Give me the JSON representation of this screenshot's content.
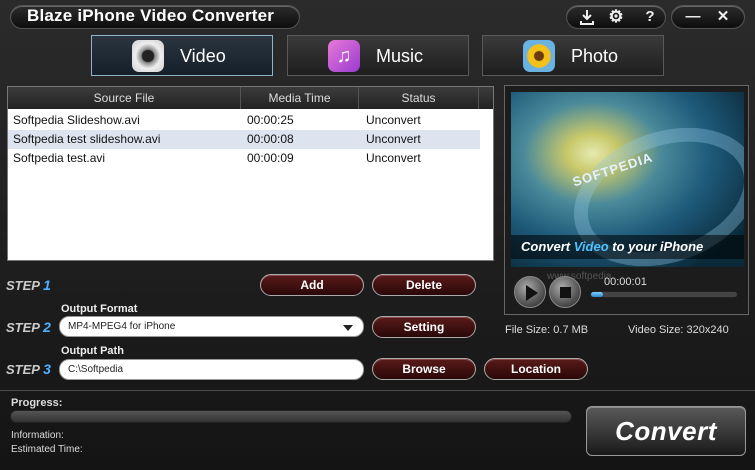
{
  "window": {
    "title": "Blaze iPhone Video Converter",
    "controls": {
      "minimize": "—",
      "close": "✕",
      "help": "?"
    }
  },
  "tabs": [
    {
      "label": "Video",
      "icon": "camera-icon",
      "active": true
    },
    {
      "label": "Music",
      "icon": "music-note-icon",
      "active": false
    },
    {
      "label": "Photo",
      "icon": "sunflower-photo-icon",
      "active": false
    }
  ],
  "file_list": {
    "columns": [
      "Source File",
      "Media Time",
      "Status"
    ],
    "rows": [
      {
        "name": "Softpedia Slideshow.avi",
        "time": "00:00:25",
        "status": "Unconvert"
      },
      {
        "name": "Softpedia test slideshow.avi",
        "time": "00:00:08",
        "status": "Unconvert"
      },
      {
        "name": "Softpedia test.avi",
        "time": "00:00:09",
        "status": "Unconvert"
      }
    ]
  },
  "preview": {
    "video_text": "SOFTPEDIA",
    "caption_before": "Convert ",
    "caption_highlight": "Video",
    "caption_after": " to your iPhone",
    "watermark": "www.softpedia",
    "current_time": "00:00:01",
    "seek_fraction": 0.08,
    "file_size": "File Size: 0.7 MB",
    "video_size": "Video Size: 320x240"
  },
  "steps": {
    "step_word": "STEP",
    "step1": "1",
    "step2": "2",
    "step3": "3",
    "add_label": "Add",
    "delete_label": "Delete",
    "output_format_label": "Output Format",
    "output_format_value": "MP4-MPEG4 for iPhone",
    "setting_label": "Setting",
    "output_path_label": "Output Path",
    "output_path_value": "C:\\Softpedia",
    "browse_label": "Browse",
    "location_label": "Location"
  },
  "bottom": {
    "progress_label": "Progress:",
    "information_label": "Information:",
    "estimated_label": "Estimated Time:",
    "convert_label": "Convert"
  },
  "colors": {
    "accent_blue": "#4db0ff",
    "button_red": "#5a1a1a",
    "row_alt": "#dde4ef"
  }
}
